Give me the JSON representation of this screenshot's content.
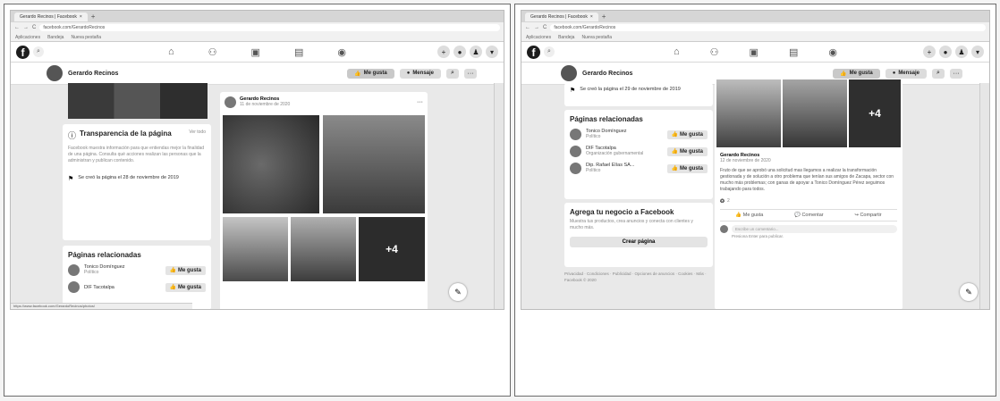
{
  "browser": {
    "tab_title": "Gerardo Recinos | Facebook",
    "tab_close": "×",
    "new_tab": "+",
    "nav_buttons": [
      "←",
      "→",
      "C"
    ],
    "url": "facebook.com/GerardoRecinos",
    "bookmarks": [
      "Aplicaciones",
      "Bandeja",
      "Nueva pestaña"
    ]
  },
  "facebook": {
    "logo": "f",
    "search_icon": "⌕",
    "nav_icons": [
      "⌂",
      "⚇",
      "▣",
      "▤",
      "◉"
    ],
    "nav_right_icons": [
      "+",
      "●",
      "♟",
      "▾"
    ],
    "page_name": "Gerardo Recinos",
    "like_button": "Me gusta",
    "message_button": "Mensaje",
    "search_button": "⌕",
    "more_button": "···"
  },
  "left_screenshot": {
    "transparency_title": "Transparencia de la página",
    "transparency_link": "Ver todo",
    "transparency_text": "Facebook muestra información para que entiendas mejor la finalidad de una página. Consulta qué acciones realizan las personas que la administran y publican contenido.",
    "created_text": "Se creó la página el 28 de noviembre de 2019",
    "related_title": "Páginas relacionadas",
    "related_pages": [
      {
        "name": "Tonico Domínguez",
        "sub": "Político",
        "button": "Me gusta"
      },
      {
        "name": "DIF Tacotalpa",
        "sub": "",
        "button": "Me gusta"
      }
    ],
    "post_author": "Gerardo Recinos",
    "post_date": "11 de noviembre de 2020",
    "post_more": "···",
    "photo_overlay": "+4",
    "status_url": "https://www.facebook.com/GerardoRecinos/photos/"
  },
  "right_screenshot": {
    "created_text": "Se creó la página el 29 de noviembre de 2019",
    "related_title": "Páginas relacionadas",
    "related_pages": [
      {
        "name": "Tonico Domínguez",
        "sub": "Político",
        "button": "Me gusta"
      },
      {
        "name": "DIF Tacotalpa",
        "sub": "Organización gubernamental",
        "button": "Me gusta"
      },
      {
        "name": "Dip. Rafael Elías SA...",
        "sub": "Político",
        "button": "Me gusta"
      }
    ],
    "business_title": "Agrega tu negocio a Facebook",
    "business_text": "Muestra tus productos, crea anuncios y conecta con clientes y mucho más.",
    "create_page": "Crear página",
    "footer": "Privacidad · Condiciones · Publicidad · Opciones de anuncios · Cookies · Más · Facebook © 2020",
    "post_author": "Gerardo Recinos",
    "post_date": "12 de noviembre de 2020",
    "photo_overlay": "+4",
    "post_text": "Fruto de que se aprobó una solicitud mas llegamos a realizar la transformación gestionada y de solución a otro problema que tenían sus amigos de Zacapa, sector con mucho más problemas; con ganas de apoyar a Tonico Domínguez Pérez seguimos trabajando para todos.",
    "reactions": "2",
    "actions": [
      "Me gusta",
      "Comentar",
      "Compartir"
    ],
    "comment_placeholder": "Escribe un comentario...",
    "comment_hint": "Presiona Enter para publicar."
  }
}
